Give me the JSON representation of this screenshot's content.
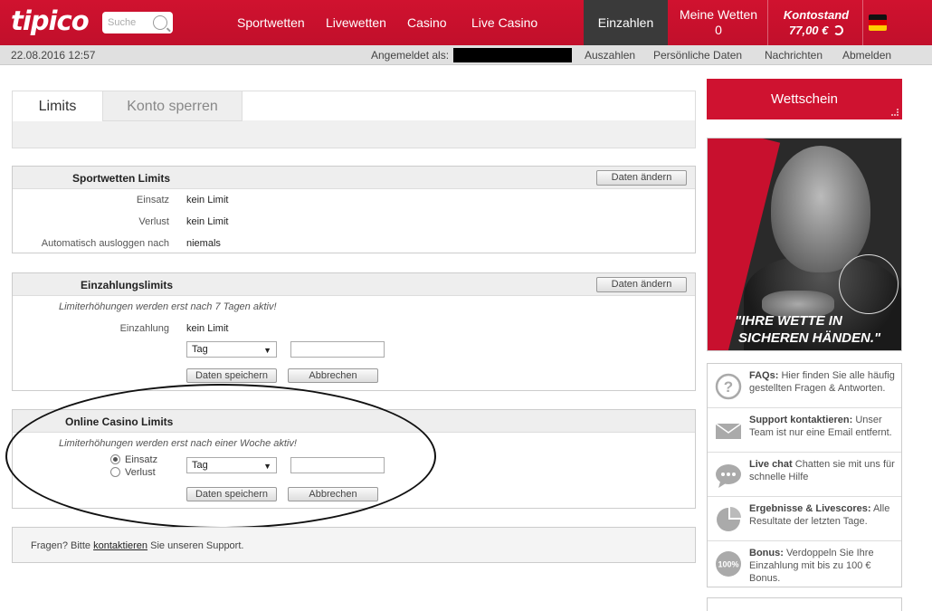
{
  "header": {
    "logo": "tipico",
    "search_placeholder": "Suche",
    "nav": [
      "Sportwetten",
      "Livewetten",
      "Casino",
      "Live Casino"
    ],
    "einzahlen": "Einzahlen",
    "meine_wetten_label": "Meine Wetten",
    "meine_wetten_count": "0",
    "kontostand_label": "Kontostand",
    "kontostand_value": "77,00 €"
  },
  "subbar": {
    "datetime": "22.08.2016  12:57",
    "angemeldet": "Angemeldet als",
    "links": [
      "Auszahlen",
      "Persönliche Daten",
      "Nachrichten",
      "Abmelden"
    ]
  },
  "tabs": [
    "Limits",
    "Konto sperren"
  ],
  "sport": {
    "title": "Sportwetten Limits",
    "button": "Daten ändern",
    "rows": [
      {
        "label": "Einsatz",
        "value": "kein Limit"
      },
      {
        "label": "Verlust",
        "value": "kein Limit"
      },
      {
        "label": "Automatisch ausloggen nach",
        "value": "niemals"
      }
    ]
  },
  "einzahlung": {
    "title": "Einzahlungslimits",
    "button": "Daten ändern",
    "note": "Limiterhöhungen werden erst nach 7 Tagen aktiv!",
    "label": "Einzahlung",
    "value": "kein Limit",
    "select": "Tag",
    "save": "Daten speichern",
    "cancel": "Abbrechen"
  },
  "casino": {
    "title": "Online Casino Limits",
    "note": "Limiterhöhungen werden erst nach einer Woche aktiv!",
    "radio1": "Einsatz",
    "radio2": "Verlust",
    "select": "Tag",
    "save": "Daten speichern",
    "cancel": "Abbrechen"
  },
  "footer": {
    "prefix": "Fragen? Bitte",
    "link": "kontaktieren",
    "suffix": "Sie unseren Support."
  },
  "sidebar": {
    "wettschein": "Wettschein",
    "slogan1": "\"IHRE WETTE IN",
    "slogan2": "SICHEREN HÄNDEN.\"",
    "help": [
      {
        "icon": "question-icon",
        "title": "FAQs:",
        "text": "Hier finden Sie alle häufig gestellten Fragen & Antworten."
      },
      {
        "icon": "mail-icon",
        "title": "Support kontaktieren:",
        "text": "Unser Team ist nur eine Email entfernt."
      },
      {
        "icon": "chat-icon",
        "title": "Live chat",
        "text": "Chatten sie mit uns für schnelle Hilfe"
      },
      {
        "icon": "pie-icon",
        "title": "Ergebnisse & Livescores:",
        "text": "Alle Resultate der letzten Tage."
      },
      {
        "icon": "bonus-icon",
        "title": "Bonus:",
        "text": "Verdoppeln Sie Ihre Einzahlung mit bis zu 100 € Bonus."
      }
    ],
    "bonus_badge": "100%"
  }
}
